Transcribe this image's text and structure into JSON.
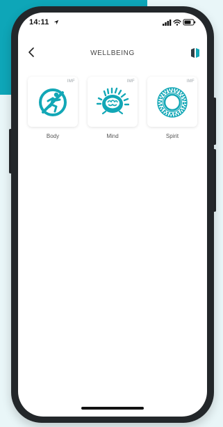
{
  "status_bar": {
    "time": "14:11",
    "location_icon": "location-arrow-icon",
    "signal_icon": "cellular-signal-icon",
    "wifi_icon": "wifi-icon",
    "battery_icon": "battery-icon"
  },
  "nav": {
    "title": "WELLBEING",
    "back_icon": "chevron-left-icon",
    "right_icon": "split-panels-icon"
  },
  "cards": [
    {
      "label": "Body",
      "tag": "IMF",
      "icon": "runner-circle-icon"
    },
    {
      "label": "Mind",
      "tag": "IMF",
      "icon": "brain-head-icon"
    },
    {
      "label": "Spirit",
      "tag": "IMF",
      "icon": "mandala-ring-icon"
    }
  ],
  "colors": {
    "accent": "#12a7b6",
    "background": "#e9f6f8",
    "phone_frame": "#23272a",
    "teal_block": "#0ea6b8"
  }
}
